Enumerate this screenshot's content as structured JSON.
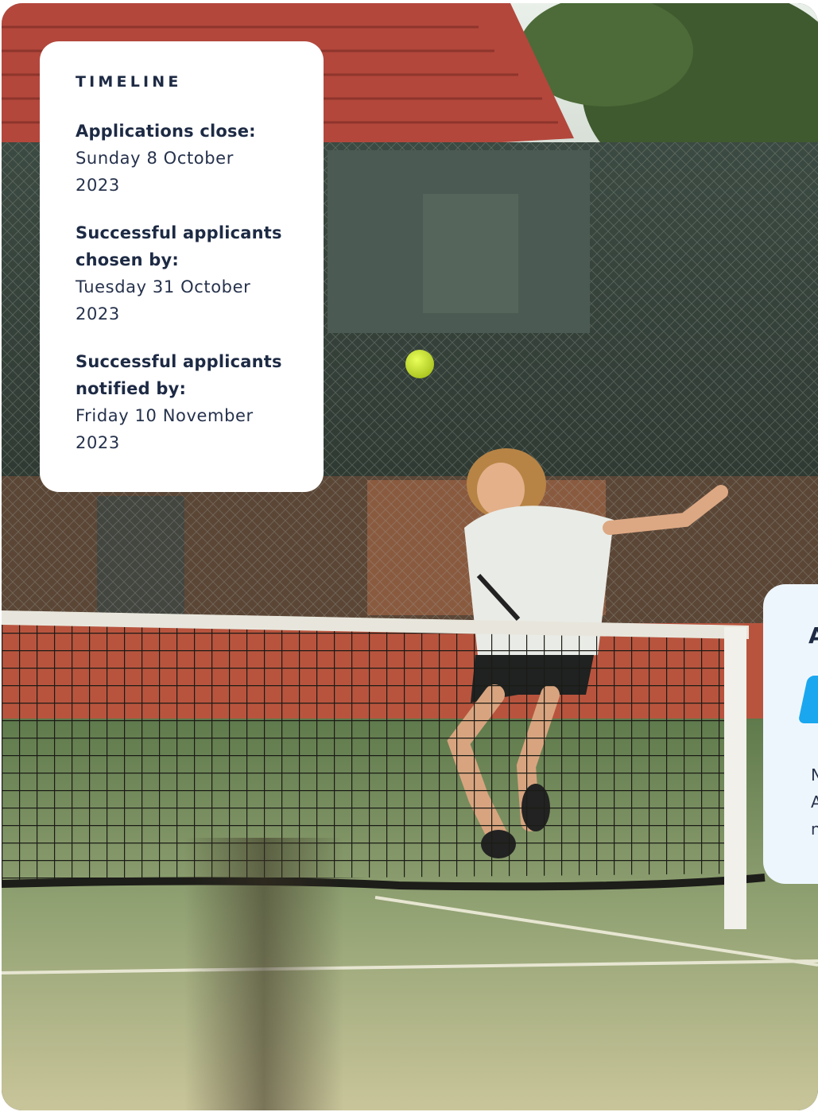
{
  "timeline": {
    "heading": "TIMELINE",
    "items": [
      {
        "label": "Applications close:",
        "date_line1": "Sunday 8 October",
        "date_line2": "2023"
      },
      {
        "label_line1": "Successful applicants",
        "label_line2": "chosen by:",
        "date_line1": "Tuesday 31 October",
        "date_line2": "2023"
      },
      {
        "label_line1": "Successful applicants",
        "label_line2": "notified by:",
        "date_line1": "Friday 10 November",
        "date_line2": "2023"
      }
    ]
  },
  "apply_card": {
    "heading_fragment": "A",
    "note_fragments": [
      "N",
      "A",
      "n"
    ]
  },
  "colors": {
    "card_text": "#1d2a44",
    "apply_card_bg": "#eef6fd",
    "apply_button": "#1aa7ef"
  },
  "icons": [
    "tennis-ball-icon"
  ]
}
